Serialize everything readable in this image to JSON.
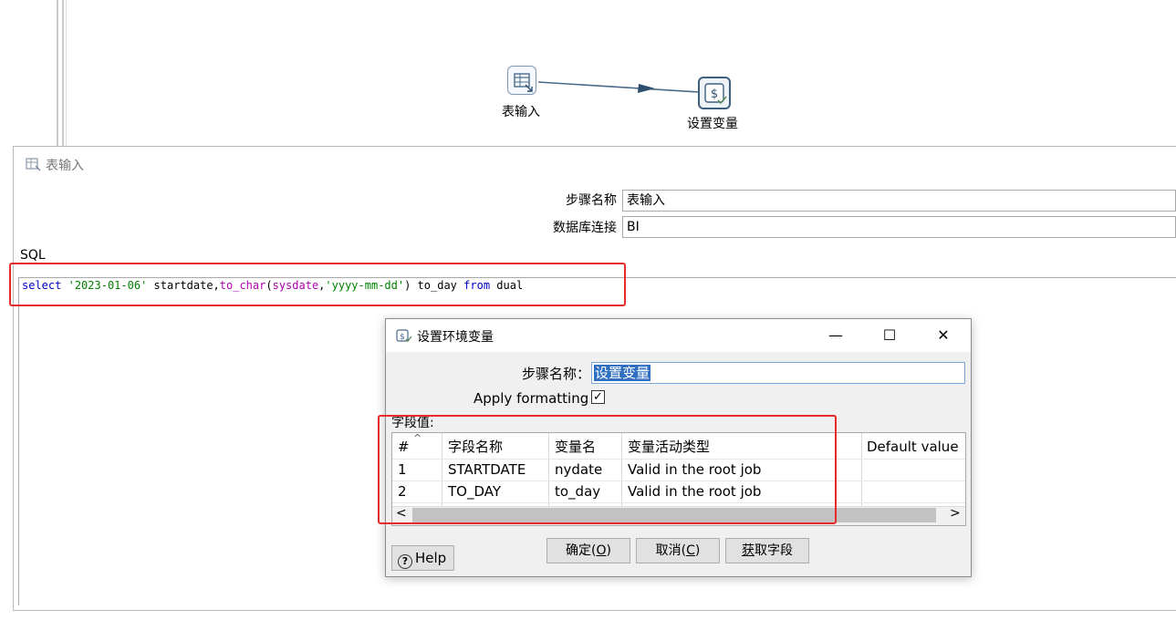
{
  "canvas": {
    "steps": [
      {
        "label": "表输入"
      },
      {
        "label": "设置变量"
      }
    ]
  },
  "table_input_dialog": {
    "title": "表输入",
    "step_name_label": "步骤名称",
    "step_name_value": "表输入",
    "db_conn_label": "数据库连接",
    "db_conn_value": "BI",
    "sql_label": "SQL",
    "sql": {
      "p1": "select",
      "p2": "'2023-01-06'",
      "p3": " startdate,",
      "p4": "to_char",
      "p5": "(",
      "p6": "sysdate",
      "p7": ",",
      "p8": "'yyyy-mm-dd'",
      "p9": ") to_day ",
      "p10": "from",
      "p11": " dual"
    }
  },
  "set_variables_dialog": {
    "title": "设置环境变量",
    "minimize": "—",
    "maximize": "☐",
    "close": "✕",
    "step_name_label": "步骤名称：",
    "step_name_value": "设置变量",
    "apply_formatting_label": "Apply formatting",
    "apply_formatting_checked": "✓",
    "fields_label": "字段值:",
    "columns": [
      "#",
      "字段名称",
      "变量名",
      "变量活动类型",
      "Default value"
    ],
    "sort_indicator": "^",
    "rows": [
      {
        "num": "1",
        "field": "STARTDATE",
        "var": "nydate",
        "type": "Valid in the root job",
        "default": ""
      },
      {
        "num": "2",
        "field": "TO_DAY",
        "var": "to_day",
        "type": "Valid in the root job",
        "default": ""
      }
    ],
    "scroll_left": "<",
    "scroll_right": ">",
    "help_label": "Help",
    "help_icon": "?",
    "ok_label": "确定(",
    "ok_key": "O",
    "ok_tail": ")",
    "cancel_label": "取消(",
    "cancel_key": "C",
    "cancel_tail": ")",
    "get_fields_key": "获",
    "get_fields_rest": "取字段"
  },
  "colors": {
    "highlight_box": "#e62a2a",
    "selection": "#2f6fc1"
  }
}
